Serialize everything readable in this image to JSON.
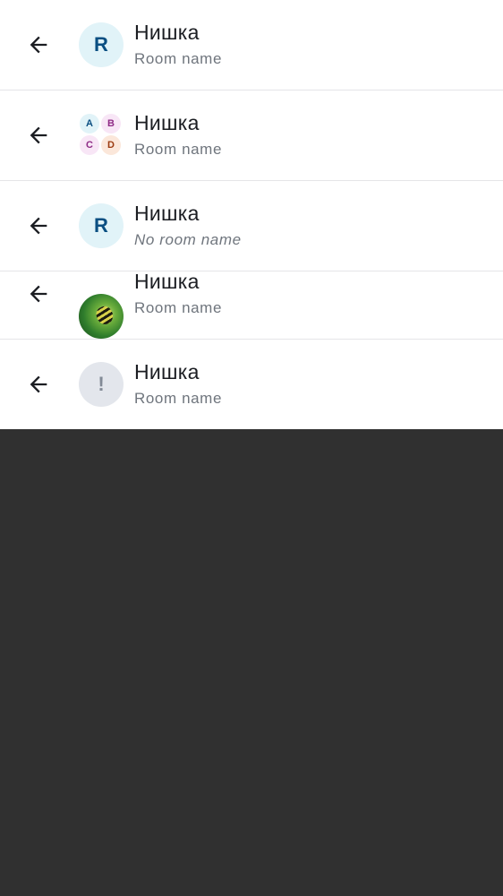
{
  "rows": [
    {
      "title": "Нишка",
      "subtitle": "Room name",
      "avatar_letter": "R"
    },
    {
      "title": "Нишка",
      "subtitle": "Room name",
      "cluster": [
        {
          "letter": "A",
          "bg": "#e1f3f8",
          "fg": "#0b4f82"
        },
        {
          "letter": "B",
          "bg": "#f8e6f6",
          "fg": "#8f2b86"
        },
        {
          "letter": "C",
          "bg": "#f8e6f6",
          "fg": "#8f2b86"
        },
        {
          "letter": "D",
          "bg": "#fbe7da",
          "fg": "#9b3b10"
        }
      ]
    },
    {
      "title": "Нишка",
      "subtitle": "No room name",
      "avatar_letter": "R"
    },
    {
      "title": "Нишка",
      "subtitle": "Room name",
      "avatar_image": "caterpillar-photo"
    },
    {
      "title": "Нишка",
      "subtitle": "Room name",
      "avatar_error": "!"
    }
  ],
  "icons": {
    "back": "arrow-back-icon"
  },
  "colors": {
    "avatar_bg": "#e1f3f8",
    "avatar_fg": "#0b4f82",
    "error_bg": "#e3e6ec",
    "page_bg": "#303030"
  }
}
